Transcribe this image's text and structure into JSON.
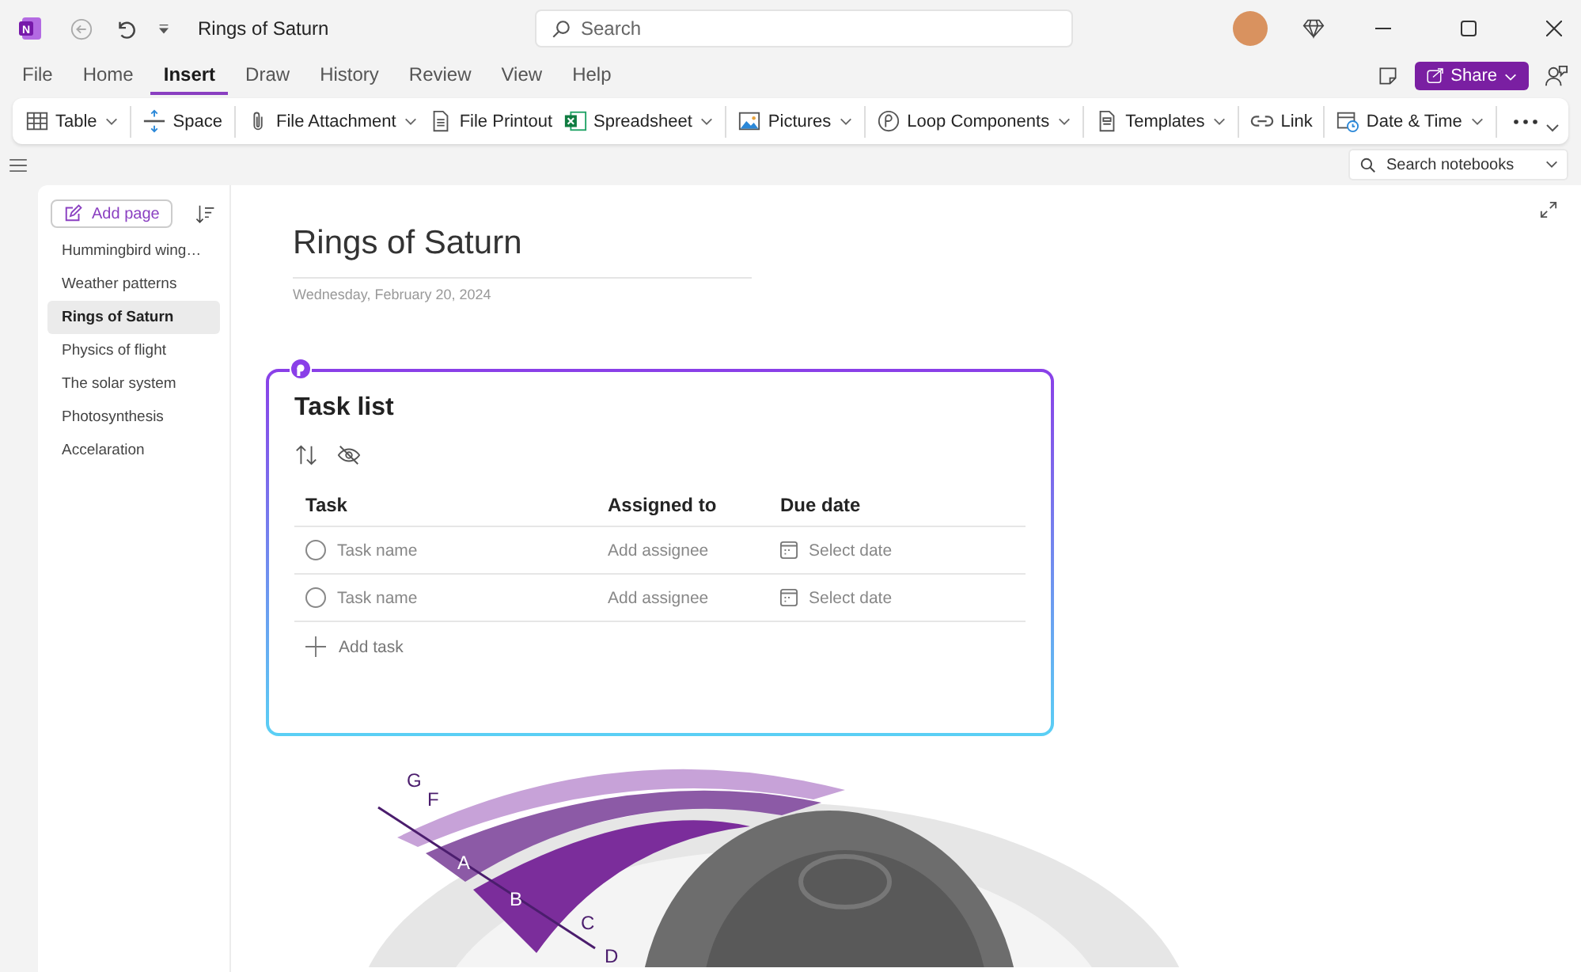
{
  "window": {
    "title": "Rings of Saturn"
  },
  "app_logo": {
    "letter": "N"
  },
  "search": {
    "placeholder": "Search"
  },
  "menu_tabs": [
    {
      "label": "File",
      "selected": false
    },
    {
      "label": "Home",
      "selected": false
    },
    {
      "label": "Insert",
      "selected": true
    },
    {
      "label": "Draw",
      "selected": false
    },
    {
      "label": "History",
      "selected": false
    },
    {
      "label": "Review",
      "selected": false
    },
    {
      "label": "View",
      "selected": false
    },
    {
      "label": "Help",
      "selected": false
    }
  ],
  "share_button": {
    "label": "Share"
  },
  "ribbon_groups": [
    [
      {
        "label": "Table",
        "dropdown": true
      }
    ],
    [
      {
        "label": "Space",
        "dropdown": false
      }
    ],
    [
      {
        "label": "File Attachment",
        "dropdown": true
      },
      {
        "label": "File Printout",
        "dropdown": false
      },
      {
        "label": "Spreadsheet",
        "dropdown": true
      }
    ],
    [
      {
        "label": "Pictures",
        "dropdown": true
      }
    ],
    [
      {
        "label": "Loop Components",
        "dropdown": true
      }
    ],
    [
      {
        "label": "Templates",
        "dropdown": true
      }
    ],
    [
      {
        "label": "Link",
        "dropdown": false
      }
    ],
    [
      {
        "label": "Date & Time",
        "dropdown": true
      }
    ]
  ],
  "notebook_search": {
    "placeholder": "Search notebooks"
  },
  "sidebar": {
    "add_page": "Add page",
    "pages": [
      {
        "label": "Hummingbird wing…",
        "selected": false
      },
      {
        "label": "Weather patterns",
        "selected": false
      },
      {
        "label": "Rings of Saturn",
        "selected": true
      },
      {
        "label": "Physics of flight",
        "selected": false
      },
      {
        "label": "The solar system",
        "selected": false
      },
      {
        "label": "Photosynthesis",
        "selected": false
      },
      {
        "label": "Accelaration",
        "selected": false
      }
    ]
  },
  "page": {
    "title": "Rings of Saturn",
    "date": "Wednesday, February 20, 2024"
  },
  "task_list": {
    "title": "Task list",
    "columns": [
      "Task",
      "Assigned to",
      "Due date"
    ],
    "rows": [
      {
        "task": "Task name",
        "assignee": "Add assignee",
        "due": "Select date",
        "done": false
      },
      {
        "task": "Task name",
        "assignee": "Add assignee",
        "due": "Select date",
        "done": false
      }
    ],
    "add_task": "Add task"
  },
  "diagram": {
    "labels": [
      "G",
      "F",
      "A",
      "B",
      "C",
      "D"
    ]
  }
}
